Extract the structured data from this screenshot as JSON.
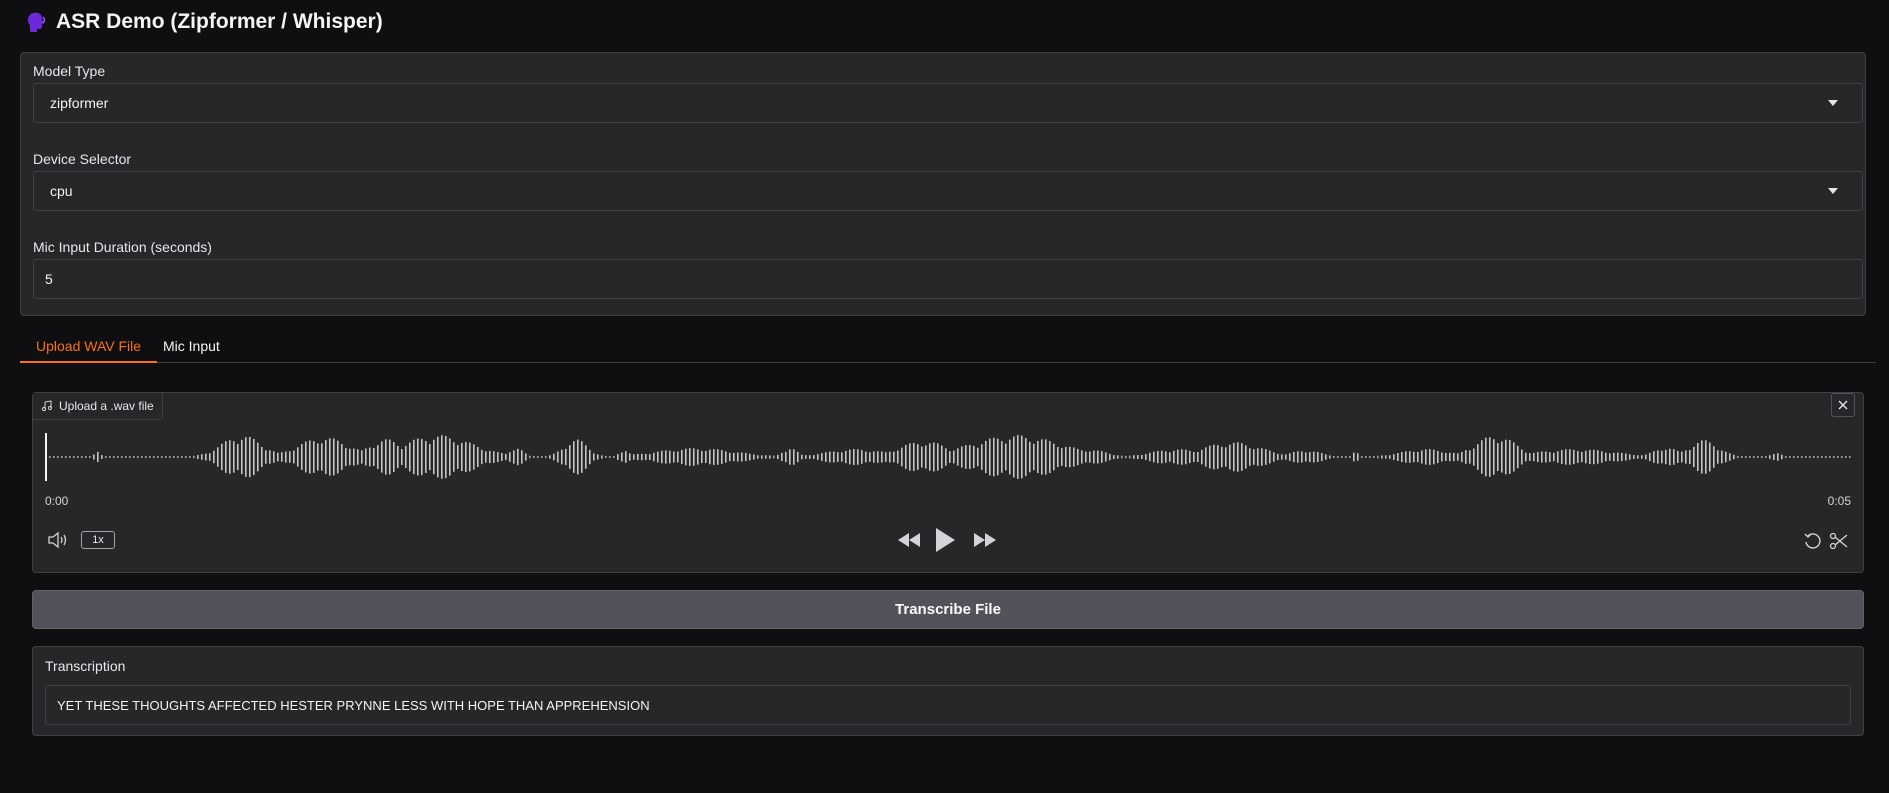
{
  "app": {
    "title": "ASR Demo (Zipformer / Whisper)",
    "title_icon": "speaking-head-icon"
  },
  "settings": {
    "model_type": {
      "label": "Model Type",
      "value": "zipformer"
    },
    "device": {
      "label": "Device Selector",
      "value": "cpu"
    },
    "mic_duration": {
      "label": "Mic Input Duration (seconds)",
      "value": "5"
    }
  },
  "tabs": [
    {
      "label": "Upload WAV File",
      "active": true
    },
    {
      "label": "Mic Input",
      "active": false
    }
  ],
  "audio": {
    "upload_label": "Upload a .wav file",
    "time_start": "0:00",
    "time_end": "0:05",
    "playback_rate": "1x"
  },
  "actions": {
    "transcribe_label": "Transcribe File"
  },
  "transcription": {
    "label": "Transcription",
    "text": "YET THESE THOUGHTS AFFECTED HESTER PRYNNE LESS WITH HOPE THAN APPREHENSION"
  },
  "colors": {
    "accent": "#f97316",
    "background": "#0f0f11",
    "panel": "#27272a",
    "button": "#52525b"
  }
}
